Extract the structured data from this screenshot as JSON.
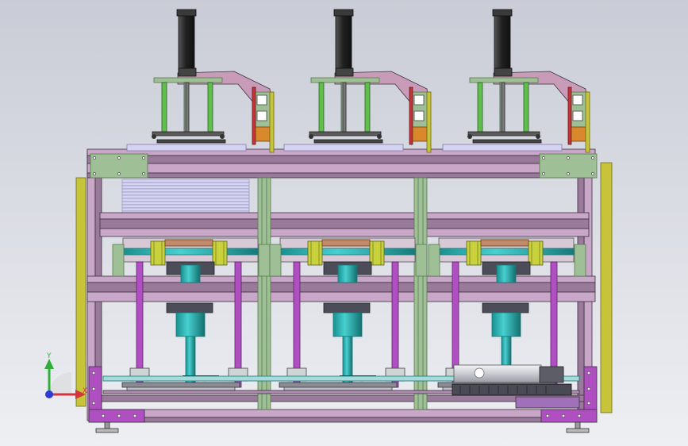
{
  "viewport": {
    "background_top": "#c9ccd6",
    "background_bottom": "#eeeff3"
  },
  "colors": {
    "frame_pink": "#c9a7c9",
    "frame_pink_dark": "#9a7a9a",
    "frame_edge": "#3b2f3b",
    "plate_green": "#9fbf96",
    "plate_green_dark": "#557a4d",
    "stack_lavender": "#d4d3f2",
    "shaft_cyan": "#2fb8b8",
    "shaft_cyan_dark": "#137878",
    "rod_magenta": "#b04fc2",
    "roller_yellow": "#c9d23c",
    "cylinder_black": "#2d2d2d",
    "guide_rod_green": "#5fbf4a",
    "rail_yellow": "#c8c43a",
    "bracket_orange": "#d9882b",
    "bracket_red": "#c4323a",
    "motor_silver": "#d5d8dd",
    "motor_dark": "#4a4a55",
    "base_purple": "#a070b8"
  },
  "triad": {
    "y_label": "Y",
    "x_label": "X",
    "y_color": "#2fae3a",
    "x_color": "#d4353c",
    "z_color": "#2a3bd6"
  },
  "units": [
    {
      "id": "left"
    },
    {
      "id": "center"
    },
    {
      "id": "right"
    }
  ]
}
